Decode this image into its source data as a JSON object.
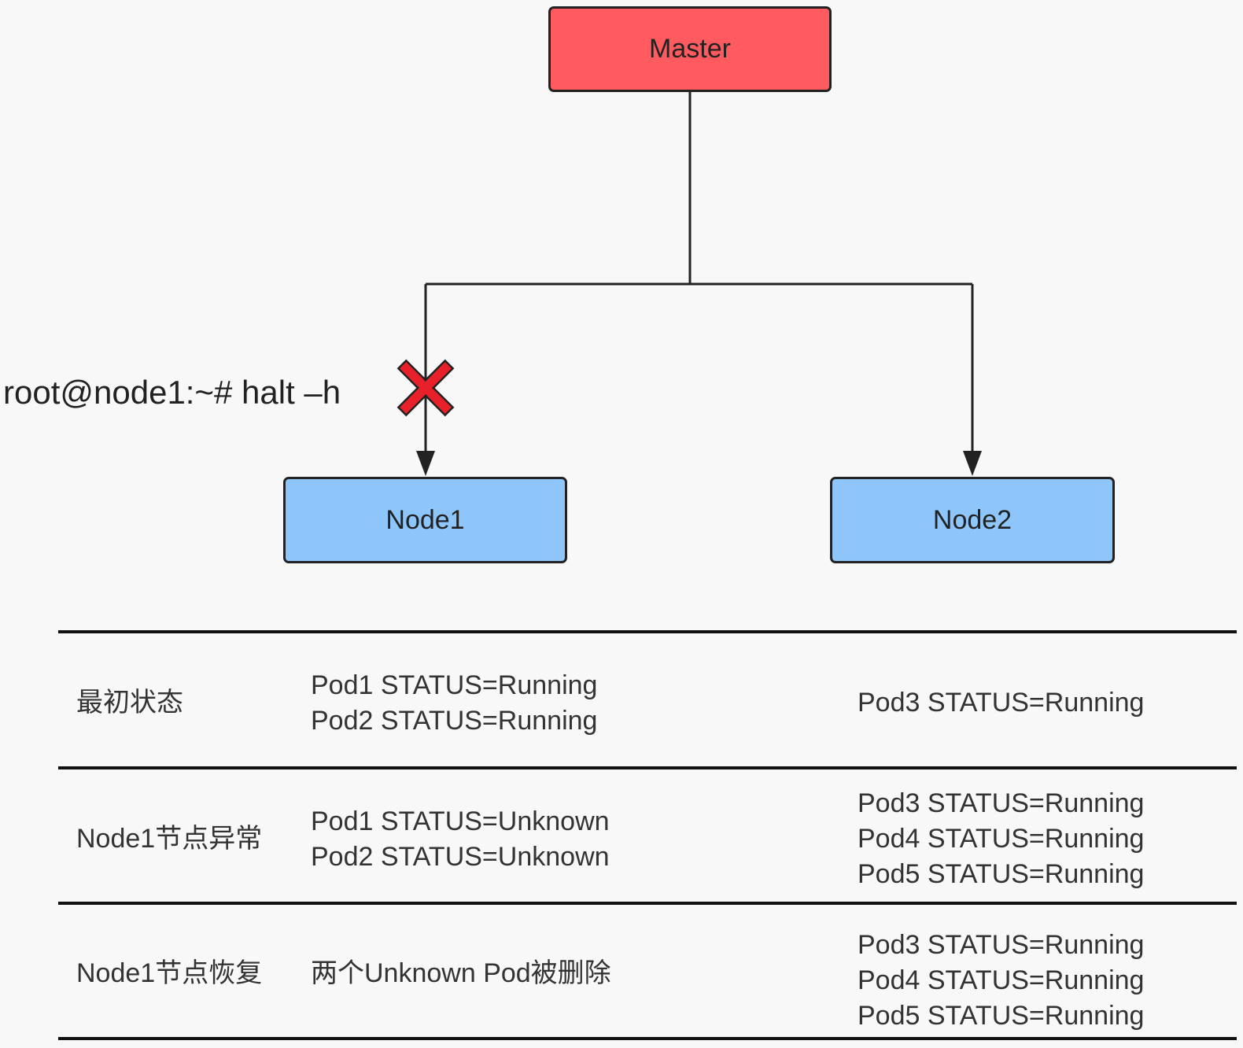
{
  "nodes": {
    "master": {
      "label": "Master",
      "color": "#ff5a5f"
    },
    "node1": {
      "label": "Node1",
      "color": "#8ec6fb"
    },
    "node2": {
      "label": "Node2",
      "color": "#8ec6fb"
    }
  },
  "command": "root@node1:~# halt –h",
  "fail_mark": {
    "icon": "red-x-icon",
    "color": "#e8202a"
  },
  "table": {
    "rows": [
      {
        "state": "最初状态",
        "node1_pods": [
          "Pod1 STATUS=Running",
          "Pod2 STATUS=Running"
        ],
        "node2_pods": [
          "Pod3 STATUS=Running"
        ]
      },
      {
        "state": "Node1节点异常",
        "node1_pods": [
          "Pod1 STATUS=Unknown",
          "Pod2 STATUS=Unknown"
        ],
        "node2_pods": [
          "Pod3 STATUS=Running",
          "Pod4 STATUS=Running",
          "Pod5 STATUS=Running"
        ]
      },
      {
        "state": "Node1节点恢复",
        "node1_pods": [
          "两个Unknown Pod被删除"
        ],
        "node2_pods": [
          "Pod3 STATUS=Running",
          "Pod4 STATUS=Running",
          "Pod5 STATUS=Running"
        ]
      }
    ]
  }
}
